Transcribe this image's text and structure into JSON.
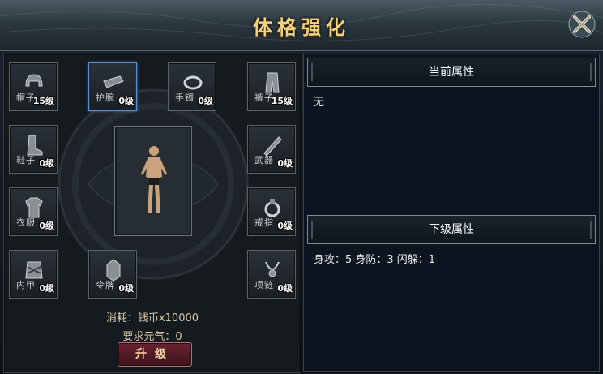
{
  "window": {
    "title": "体格强化",
    "close_icon": "close-x-icon"
  },
  "equipment": {
    "slots": [
      {
        "name": "帽子",
        "level": "15级",
        "icon": "helmet-icon",
        "selected": false
      },
      {
        "name": "护腕",
        "level": "0级",
        "icon": "bracer-icon",
        "selected": true
      },
      {
        "name": "手镯",
        "level": "0级",
        "icon": "bracelet-icon",
        "selected": false
      },
      {
        "name": "裤子",
        "level": "15级",
        "icon": "pants-icon",
        "selected": false
      },
      {
        "name": "鞋子",
        "level": "0级",
        "icon": "boots-icon",
        "selected": false
      },
      {
        "name": "武器",
        "level": "0级",
        "icon": "weapon-icon",
        "selected": false
      },
      {
        "name": "衣服",
        "level": "0级",
        "icon": "armor-icon",
        "selected": false
      },
      {
        "name": "戒指",
        "level": "0级",
        "icon": "ring-icon",
        "selected": false
      },
      {
        "name": "内甲",
        "level": "0级",
        "icon": "inner-armor-icon",
        "selected": false
      },
      {
        "name": "令牌",
        "level": "0级",
        "icon": "token-icon",
        "selected": false
      },
      {
        "name": "项链",
        "level": "0级",
        "icon": "necklace-icon",
        "selected": false
      }
    ]
  },
  "cost": {
    "text": "消耗：钱币x10000"
  },
  "requirement": {
    "text": "要求元气：0"
  },
  "actions": {
    "upgrade_label": "升级"
  },
  "attributes": {
    "current": {
      "title": "当前属性",
      "value": "无"
    },
    "next": {
      "title": "下级属性",
      "value": "身攻：5 身防：3 闪躲：1"
    }
  },
  "colors": {
    "title_gold": "#f1d27f",
    "selected_border": "#5d8ccf",
    "upgrade_button": "#6b2330"
  }
}
